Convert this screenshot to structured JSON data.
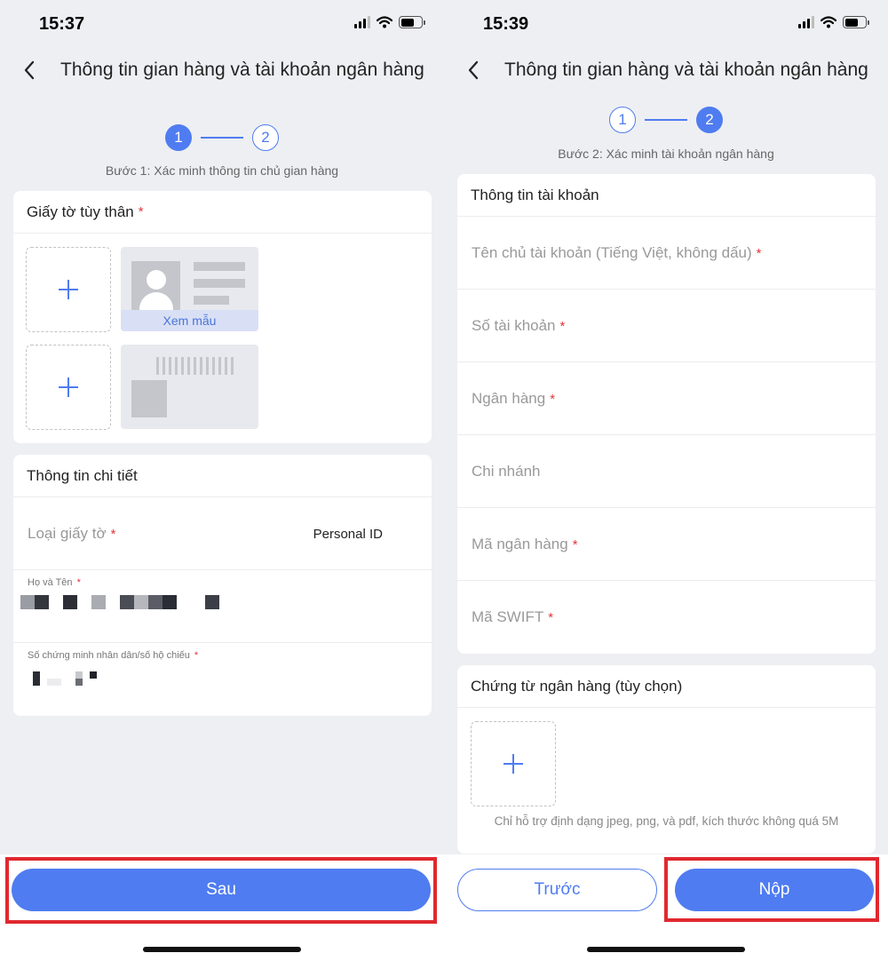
{
  "left": {
    "status": {
      "time": "15:37"
    },
    "nav": {
      "title": "Thông tin gian hàng và tài khoản ngân hàng"
    },
    "stepper": {
      "step1": "1",
      "step2": "2",
      "caption": "Bước 1: Xác minh thông tin chủ gian hàng"
    },
    "id_card": {
      "title": "Giấy tờ tùy thân",
      "required": "*",
      "sample_link": "Xem mẫu"
    },
    "details": {
      "title": "Thông tin chi tiết",
      "doc_type_label": "Loại giấy tờ",
      "doc_type_value": "Personal ID",
      "name_label": "Họ và Tên",
      "id_number_label": "Số chứng minh nhân dân/số hộ chiếu",
      "required": "*"
    },
    "footer": {
      "next_label": "Sau"
    }
  },
  "right": {
    "status": {
      "time": "15:39"
    },
    "nav": {
      "title": "Thông tin gian hàng và tài khoản ngân hàng"
    },
    "stepper": {
      "step1": "1",
      "step2": "2",
      "caption": "Bước 2: Xác minh tài khoản ngân hàng"
    },
    "account": {
      "title": "Thông tin tài khoản",
      "holder_label": "Tên chủ tài khoản (Tiếng Việt, không dấu)",
      "number_label": "Số tài khoản",
      "bank_label": "Ngân hàng",
      "branch_label": "Chi nhánh",
      "bank_code_label": "Mã ngân hàng",
      "swift_label": "Mã SWIFT",
      "required": "*"
    },
    "documents": {
      "title": "Chứng từ ngân hàng (tùy chọn)",
      "help": "Chỉ hỗ trợ định dạng jpeg, png, và pdf, kích thước không quá 5M"
    },
    "footer": {
      "prev_label": "Trước",
      "submit_label": "Nộp"
    }
  },
  "colors": {
    "accent": "#4f7cf0",
    "required": "#e0353b",
    "highlight": "#e0282f",
    "background": "#eeeff3"
  },
  "icons": [
    "back-chevron-icon",
    "signal-icon",
    "wifi-icon",
    "battery-icon",
    "plus-icon",
    "avatar-icon",
    "barcode-icon"
  ]
}
